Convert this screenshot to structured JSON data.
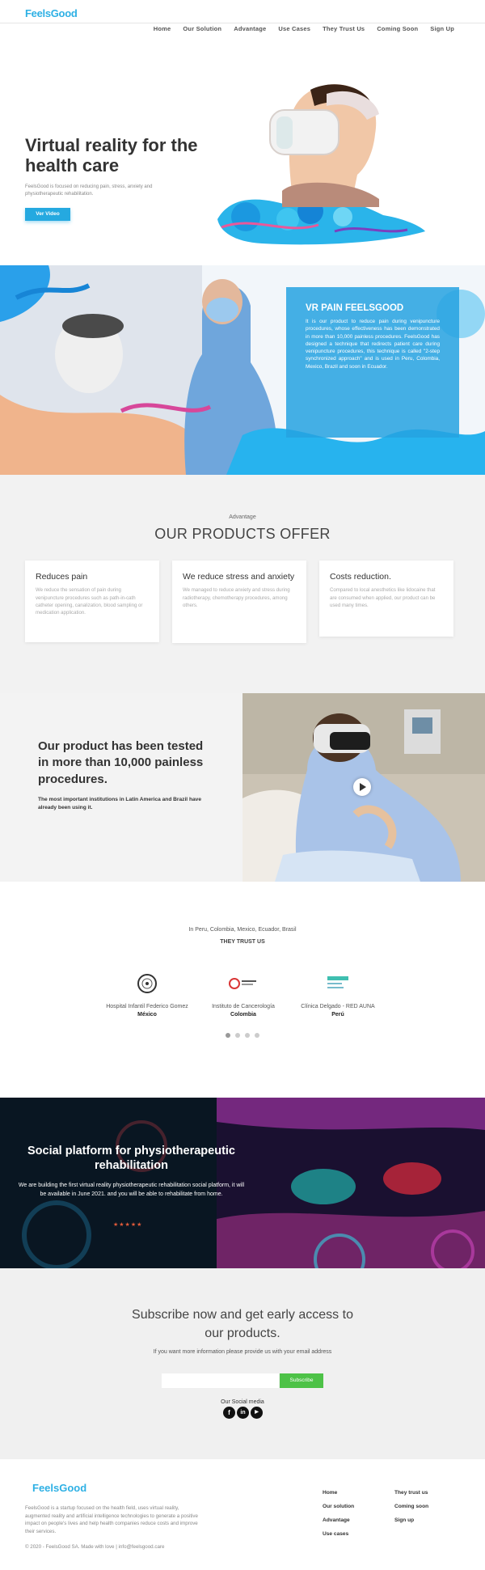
{
  "header": {
    "logo": "FeelsGood",
    "nav": [
      "Home",
      "Our Solution",
      "Advantage",
      "Use Cases",
      "They Trust Us",
      "Coming Soon",
      "Sign Up"
    ]
  },
  "hero": {
    "title": "Virtual reality for the health care",
    "subtitle": "FeelsGood is focused on reducing pain, stress, anxiety and physiotherapeutic rehabilitation.",
    "button": "Ver Video"
  },
  "vr": {
    "title": "VR PAIN FEELSGOOD",
    "text": "It is our product to reduce pain during venipuncture procedures, whose effectiveness has been demonstrated in more than 10,000 painless procedures. FeelsGood has designed a technique that redirects patient care during venipuncture procedures, this technique is called \"2-step synchronized approach\" and is used in Peru, Colombia, Mexico, Brazil and soon in Ecuador."
  },
  "products": {
    "kicker": "Advantage",
    "title": "OUR PRODUCTS OFFER",
    "cards": [
      {
        "title": "Reduces pain",
        "text": "We reduce the sensation of pain during venipuncture procedures such as path-in-cath catheter opening, canalization, blood sampling or medication application."
      },
      {
        "title": "We reduce stress and anxiety",
        "text": "We managed to reduce anxiety and stress during radiotherapy, chemotherapy procedures, among others."
      },
      {
        "title": "Costs reduction.",
        "text": "Compared to local anesthetics like lidocaine that are consumed when applied, our product can be used many times."
      }
    ]
  },
  "tested": {
    "title": "Our product has been tested in more than 10,000 painless procedures.",
    "subtitle": "The most important institutions in Latin America and Brazil have already been using it."
  },
  "trust": {
    "pre": "In Peru, Colombia, Mexico, Ecuador, Brasil",
    "title": "THEY TRUST US",
    "items": [
      {
        "name": "Hospital Infantil Federico Gomez",
        "country": "México",
        "logo": "seal-logo"
      },
      {
        "name": "Instituto de Cancerología",
        "country": "Colombia",
        "logo": "instituto-logo"
      },
      {
        "name": "Clínica Delgado - RED AUNA",
        "country": "Perú",
        "logo": "auna-logo"
      }
    ],
    "dots": 4
  },
  "social": {
    "title": "Social platform for physiotherapeutic rehabilitation",
    "text": "We are building the first virtual reality physiotherapeutic rehabilitation social platform, it will be available in June 2021. and you will be able to rehabilitate from home.",
    "stars": "★★★★★"
  },
  "subscribe": {
    "title": "Subscribe now and get early access to our products.",
    "text": "If you want more information please provide us with your email address",
    "input_placeholder": "",
    "button": "Subscribe",
    "social_label": "Our Social media",
    "icons": [
      "f",
      "in",
      "▶"
    ]
  },
  "footer": {
    "logo": "FeelsGood",
    "text": "FeelsGood is a startup focused on the health field, uses virtual reality, augmented reality and artificial intelligence technologies to generate a positive impact on people's lives and help health companies reduce costs and improve their services.",
    "copyright": "© 2020 - FeelsGood SA. Made with love | info@feelsgood.care",
    "links_col1": [
      "Home",
      "Our solution",
      "Advantage",
      "Use cases"
    ],
    "links_col2": [
      "They trust us",
      "Coming soon",
      "Sign up"
    ]
  },
  "colors": {
    "accent": "#25a9e0",
    "subscribe": "#4dc247",
    "social_bg": "#0a1a2a"
  }
}
